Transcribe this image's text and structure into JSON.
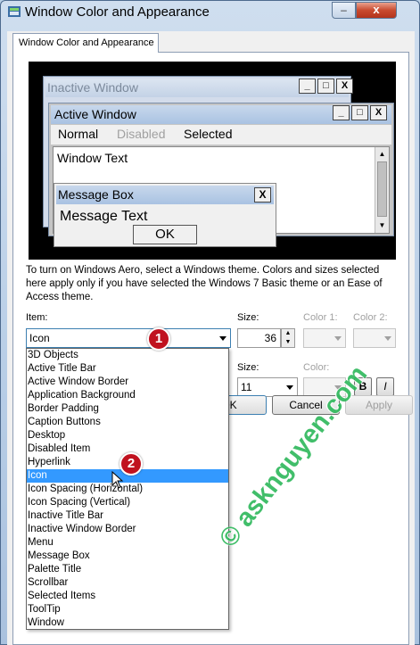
{
  "window": {
    "title": "Window Color and Appearance",
    "close_label": "x",
    "min_label": "‒",
    "icon": "color-appearance-icon"
  },
  "tab": {
    "label": "Window Color and Appearance"
  },
  "preview": {
    "inactive_title": "Inactive Window",
    "active_title": "Active Window",
    "menu_normal": "Normal",
    "menu_disabled": "Disabled",
    "menu_selected": "Selected",
    "window_text": "Window Text",
    "msgbox_title": "Message Box",
    "msgbox_text": "Message Text",
    "ok": "OK",
    "ctrl_min": "_",
    "ctrl_max": "□",
    "ctrl_close": "X"
  },
  "info_text": "To turn on Windows Aero, select a Windows theme.  Colors and sizes selected here apply only if you have selected the Windows 7 Basic theme or an Ease of Access theme.",
  "item": {
    "label": "Item:",
    "selected": "Icon",
    "options": [
      "3D Objects",
      "Active Title Bar",
      "Active Window Border",
      "Application Background",
      "Border Padding",
      "Caption Buttons",
      "Desktop",
      "Disabled Item",
      "Hyperlink",
      "Icon",
      "Icon Spacing (Horizontal)",
      "Icon Spacing (Vertical)",
      "Inactive Title Bar",
      "Inactive Window Border",
      "Menu",
      "Message Box",
      "Palette Title",
      "Scrollbar",
      "Selected Items",
      "ToolTip",
      "Window"
    ],
    "selected_index": 9
  },
  "size": {
    "label": "Size:",
    "value": "36"
  },
  "color1": {
    "label": "Color 1:"
  },
  "color2": {
    "label": "Color 2:"
  },
  "font_size": {
    "label": "Size:",
    "value": "11"
  },
  "font_color": {
    "label": "Color:"
  },
  "bold_label": "B",
  "italic_label": "I",
  "buttons": {
    "ok": "OK",
    "cancel": "Cancel",
    "apply": "Apply"
  },
  "badges": {
    "first": "1",
    "second": "2"
  },
  "watermark": "© asknguyen.com",
  "colors": {
    "selection": "#3399ff",
    "badge": "#c0121f",
    "watermark": "#2db85a"
  }
}
